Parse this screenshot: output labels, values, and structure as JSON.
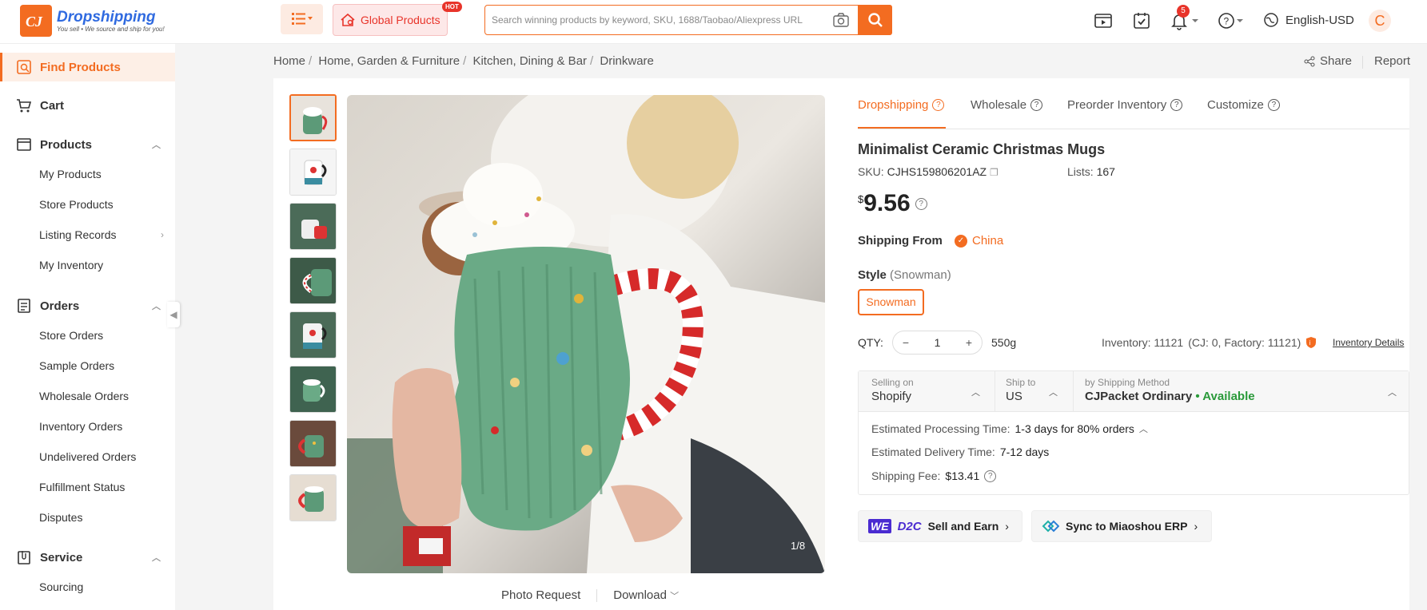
{
  "header": {
    "brand": "Dropshipping",
    "slogan": "You sell • We source and ship for you!",
    "global_products": "Global Products",
    "hot_badge": "HOT",
    "search_placeholder": "Search winning products by keyword, SKU, 1688/Taobao/Aliexpress URL",
    "notification_count": "5",
    "language": "English-USD",
    "avatar_letter": "C",
    "accent_color": "#f36c21"
  },
  "sidebar": {
    "find_products": "Find Products",
    "cart": "Cart",
    "products": "Products",
    "products_items": [
      "My Products",
      "Store Products",
      "Listing Records",
      "My Inventory"
    ],
    "orders": "Orders",
    "orders_items": [
      "Store Orders",
      "Sample Orders",
      "Wholesale Orders",
      "Inventory Orders",
      "Undelivered Orders",
      "Fulfillment Status",
      "Disputes"
    ],
    "service": "Service",
    "service_items": [
      "Sourcing"
    ]
  },
  "breadcrumb": [
    "Home",
    "Home, Garden & Furniture",
    "Kitchen, Dining & Bar",
    "Drinkware"
  ],
  "share": "Share",
  "report": "Report",
  "gallery": {
    "counter": "1/8",
    "photo_request": "Photo Request",
    "download": "Download"
  },
  "tabs": [
    "Dropshipping",
    "Wholesale",
    "Preorder Inventory",
    "Customize"
  ],
  "product": {
    "title": "Minimalist Ceramic Christmas Mugs",
    "sku_label": "SKU:",
    "sku": "CJHS159806201AZ",
    "lists_label": "Lists:",
    "lists": "167",
    "currency": "$",
    "price": "9.56",
    "shipping_from_label": "Shipping From",
    "shipping_from": "China",
    "style_label": "Style",
    "style_value": "(Snowman)",
    "style_option": "Snowman",
    "qty_label": "QTY:",
    "qty": "1",
    "weight": "550g",
    "inventory": "Inventory: 11121",
    "inventory_breakdown": "(CJ: 0, Factory: 11121)",
    "inventory_details": "Inventory Details"
  },
  "shipping": {
    "selling_on_label": "Selling on",
    "selling_on": "Shopify",
    "ship_to_label": "Ship to",
    "ship_to": "US",
    "method_label": "by Shipping Method",
    "method": "CJPacket Ordinary",
    "availability": "• Available",
    "processing_label": "Estimated Processing Time:",
    "processing": "1-3 days for 80% orders",
    "delivery_label": "Estimated Delivery Time:",
    "delivery": "7-12 days",
    "fee_label": "Shipping Fee:",
    "fee": "$13.41"
  },
  "promos": {
    "we": "WE",
    "d2c": "D2C",
    "sell_and_earn": "Sell and Earn",
    "sync": "Sync to Miaoshou ERP"
  }
}
